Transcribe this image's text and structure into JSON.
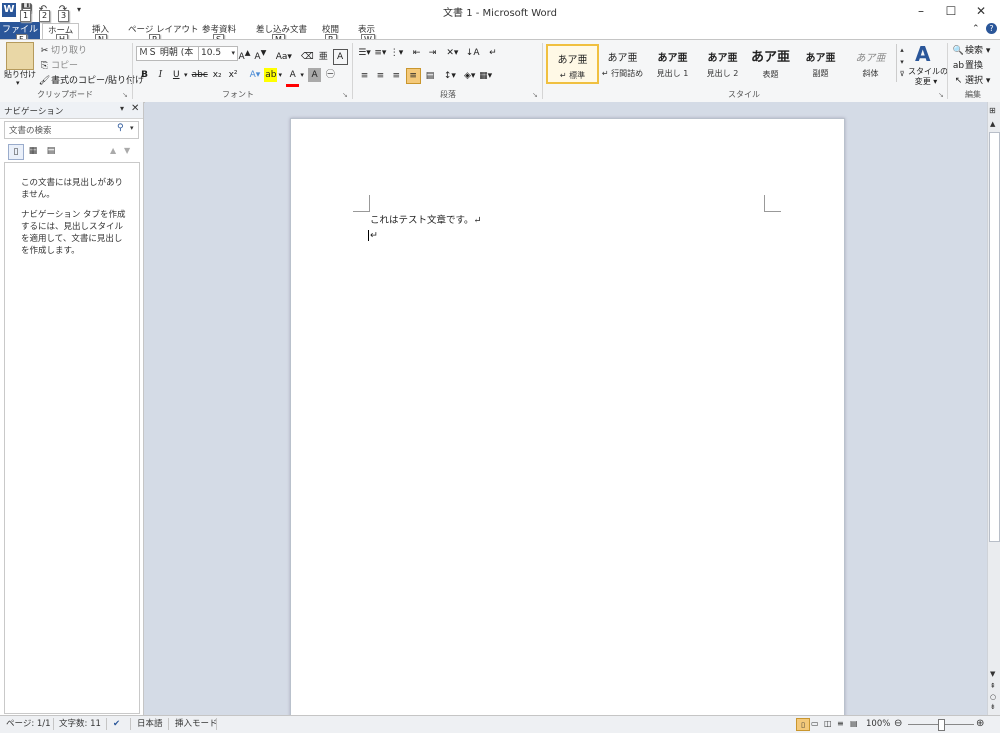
{
  "window": {
    "title": "文書 1 - Microsoft Word",
    "minimize": "–",
    "maximize": "☐",
    "close": "✕"
  },
  "keytips": {
    "qat1": "1",
    "qat2": "2",
    "qat3": "3",
    "file": "F",
    "home": "H",
    "insert": "N",
    "layout": "P",
    "references": "S",
    "mailings": "M",
    "review": "R",
    "view": "W"
  },
  "tabs": {
    "file": "ファイル",
    "home": "ホーム",
    "insert": "挿入",
    "layout": "ページ レイアウト",
    "references": "参考資料",
    "mailings": "差し込み文書",
    "review": "校閲",
    "view": "表示"
  },
  "ribbon": {
    "clipboard": {
      "paste": "貼り付け",
      "cut": "切り取り",
      "copy": "コピー",
      "format_painter": "書式のコピー/貼り付け",
      "label": "クリップボード"
    },
    "font": {
      "font_name": "ＭＳ 明朝 (本",
      "font_size": "10.5",
      "label": "フォント"
    },
    "paragraph": {
      "label": "段落"
    },
    "styles": {
      "label": "スタイル",
      "items": [
        {
          "preview": "あア亜",
          "name": "↵ 標準"
        },
        {
          "preview": "あア亜",
          "name": "↵ 行間詰め"
        },
        {
          "preview": "あア亜",
          "name": "見出し 1"
        },
        {
          "preview": "あア亜",
          "name": "見出し 2"
        },
        {
          "preview": "あア亜",
          "name": "表題"
        },
        {
          "preview": "あア亜",
          "name": "副題"
        },
        {
          "preview": "あア亜",
          "name": "斜体"
        }
      ],
      "change_styles_1": "スタイルの",
      "change_styles_2": "変更 ▾"
    },
    "editing": {
      "find": "検索 ▾",
      "replace": "置換",
      "select": "選択 ▾",
      "label": "編集"
    }
  },
  "nav": {
    "title": "ナビゲーション",
    "search_placeholder": "文書の検索",
    "msg1": "この文書には見出しがありません。",
    "msg2": "ナビゲーション タブを作成するには、見出しスタイルを適用して、文書に見出しを作成します。"
  },
  "document": {
    "line1": "これはテスト文章です。↵",
    "line2": "↵"
  },
  "status": {
    "page": "ページ: 1/1",
    "words": "文字数: 11",
    "language": "日本語",
    "mode": "挿入モード",
    "zoom": "100%"
  },
  "colors": {
    "file_tab": "#2a5699",
    "highlight": "#ffff00",
    "font_color": "#ff0000",
    "selected_style_border": "#f0c040"
  }
}
